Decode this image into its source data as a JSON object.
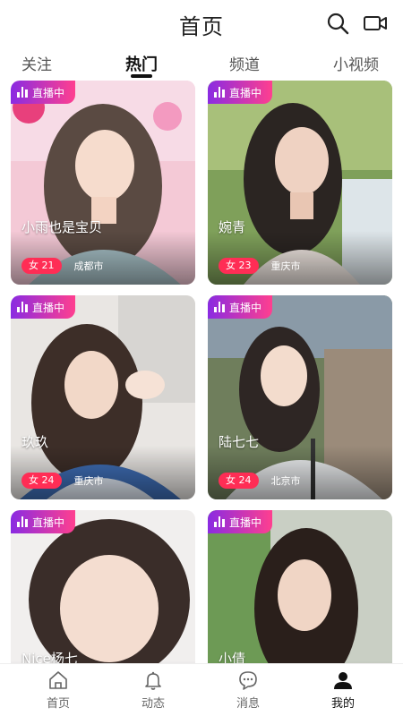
{
  "header": {
    "title": "首页"
  },
  "tabs": [
    {
      "label": "关注"
    },
    {
      "label": "热门"
    },
    {
      "label": "频道"
    },
    {
      "label": "小视频"
    }
  ],
  "live_label": "直播中",
  "cards": [
    {
      "name": "小雨也是宝贝",
      "gender_age": "女 21",
      "city": "成都市"
    },
    {
      "name": "婉青",
      "gender_age": "女 23",
      "city": "重庆市"
    },
    {
      "name": "玖玖",
      "gender_age": "女 24",
      "city": "重庆市"
    },
    {
      "name": "陆七七",
      "gender_age": "女 24",
      "city": "北京市"
    },
    {
      "name": "Nice杨七",
      "gender_age": "",
      "city": ""
    },
    {
      "name": "小倩",
      "gender_age": "",
      "city": ""
    }
  ],
  "bottom_nav": [
    {
      "label": "首页",
      "icon": "home-icon"
    },
    {
      "label": "动态",
      "icon": "bell-icon"
    },
    {
      "label": "消息",
      "icon": "chat-icon"
    },
    {
      "label": "我的",
      "icon": "user-icon"
    }
  ],
  "colors": {
    "live_gradient_start": "#8a2be2",
    "live_gradient_end": "#ff3f8f",
    "gender_badge": "#ff2d55"
  }
}
